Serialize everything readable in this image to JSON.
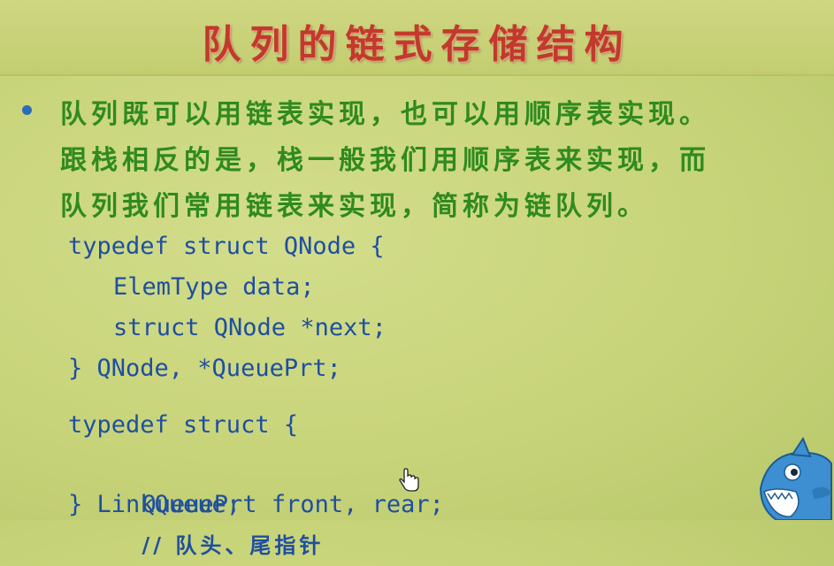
{
  "slide": {
    "title": "队列的链式存储结构",
    "lines": [
      "队列既可以用链表实现，也可以用顺序表实现。",
      "跟栈相反的是，栈一般我们用顺序表来实现，而",
      "队列我们常用链表来实现，简称为链队列。"
    ],
    "code_block_1": [
      "typedef struct QNode {",
      "ElemType data;",
      "struct QNode *next;",
      "} QNode, *QueuePrt;"
    ],
    "code_block_2": {
      "line1": "typedef struct {",
      "line2_code": "QueuePrt front, rear;",
      "line2_comment": "// 队头、尾指针",
      "line3": "} LinkQueue;"
    }
  },
  "icons": {
    "bullet": "bullet-dot",
    "cursor": "hand-pointer-icon",
    "mascot": "shark-mascot-icon"
  },
  "colors": {
    "title": "#c23a2c",
    "text": "#2f8a1f",
    "code": "#1f4fa0",
    "background": "#c8d479"
  }
}
